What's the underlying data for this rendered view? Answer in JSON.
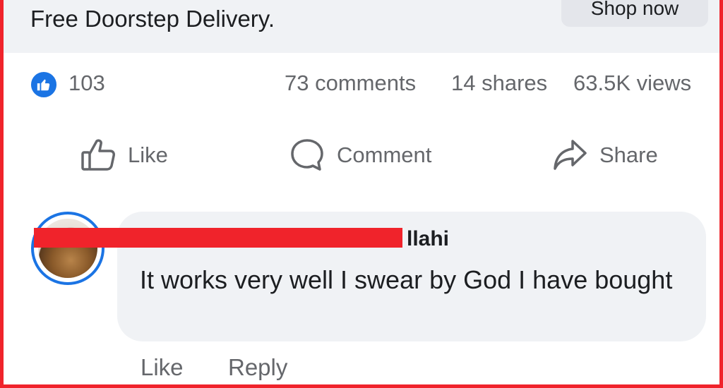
{
  "ad": {
    "text": "Free Doorstep Delivery.",
    "button_label": "Shop now"
  },
  "stats": {
    "like_count": "103",
    "comments": "73 comments",
    "shares": "14 shares",
    "views": "63.5K views"
  },
  "actions": {
    "like": "Like",
    "comment": "Comment",
    "share": "Share"
  },
  "comment": {
    "author_visible": "llahi",
    "text": "It works very well I swear by God I have bought",
    "like": "Like",
    "reply": "Reply"
  },
  "colors": {
    "accent": "#1b74e4",
    "redaction": "#f0232b",
    "muted_text": "#65676b",
    "bubble": "#f0f2f5"
  },
  "icons": [
    "thumbs-up-badge-icon",
    "thumbs-up-icon",
    "comment-icon",
    "share-icon"
  ]
}
